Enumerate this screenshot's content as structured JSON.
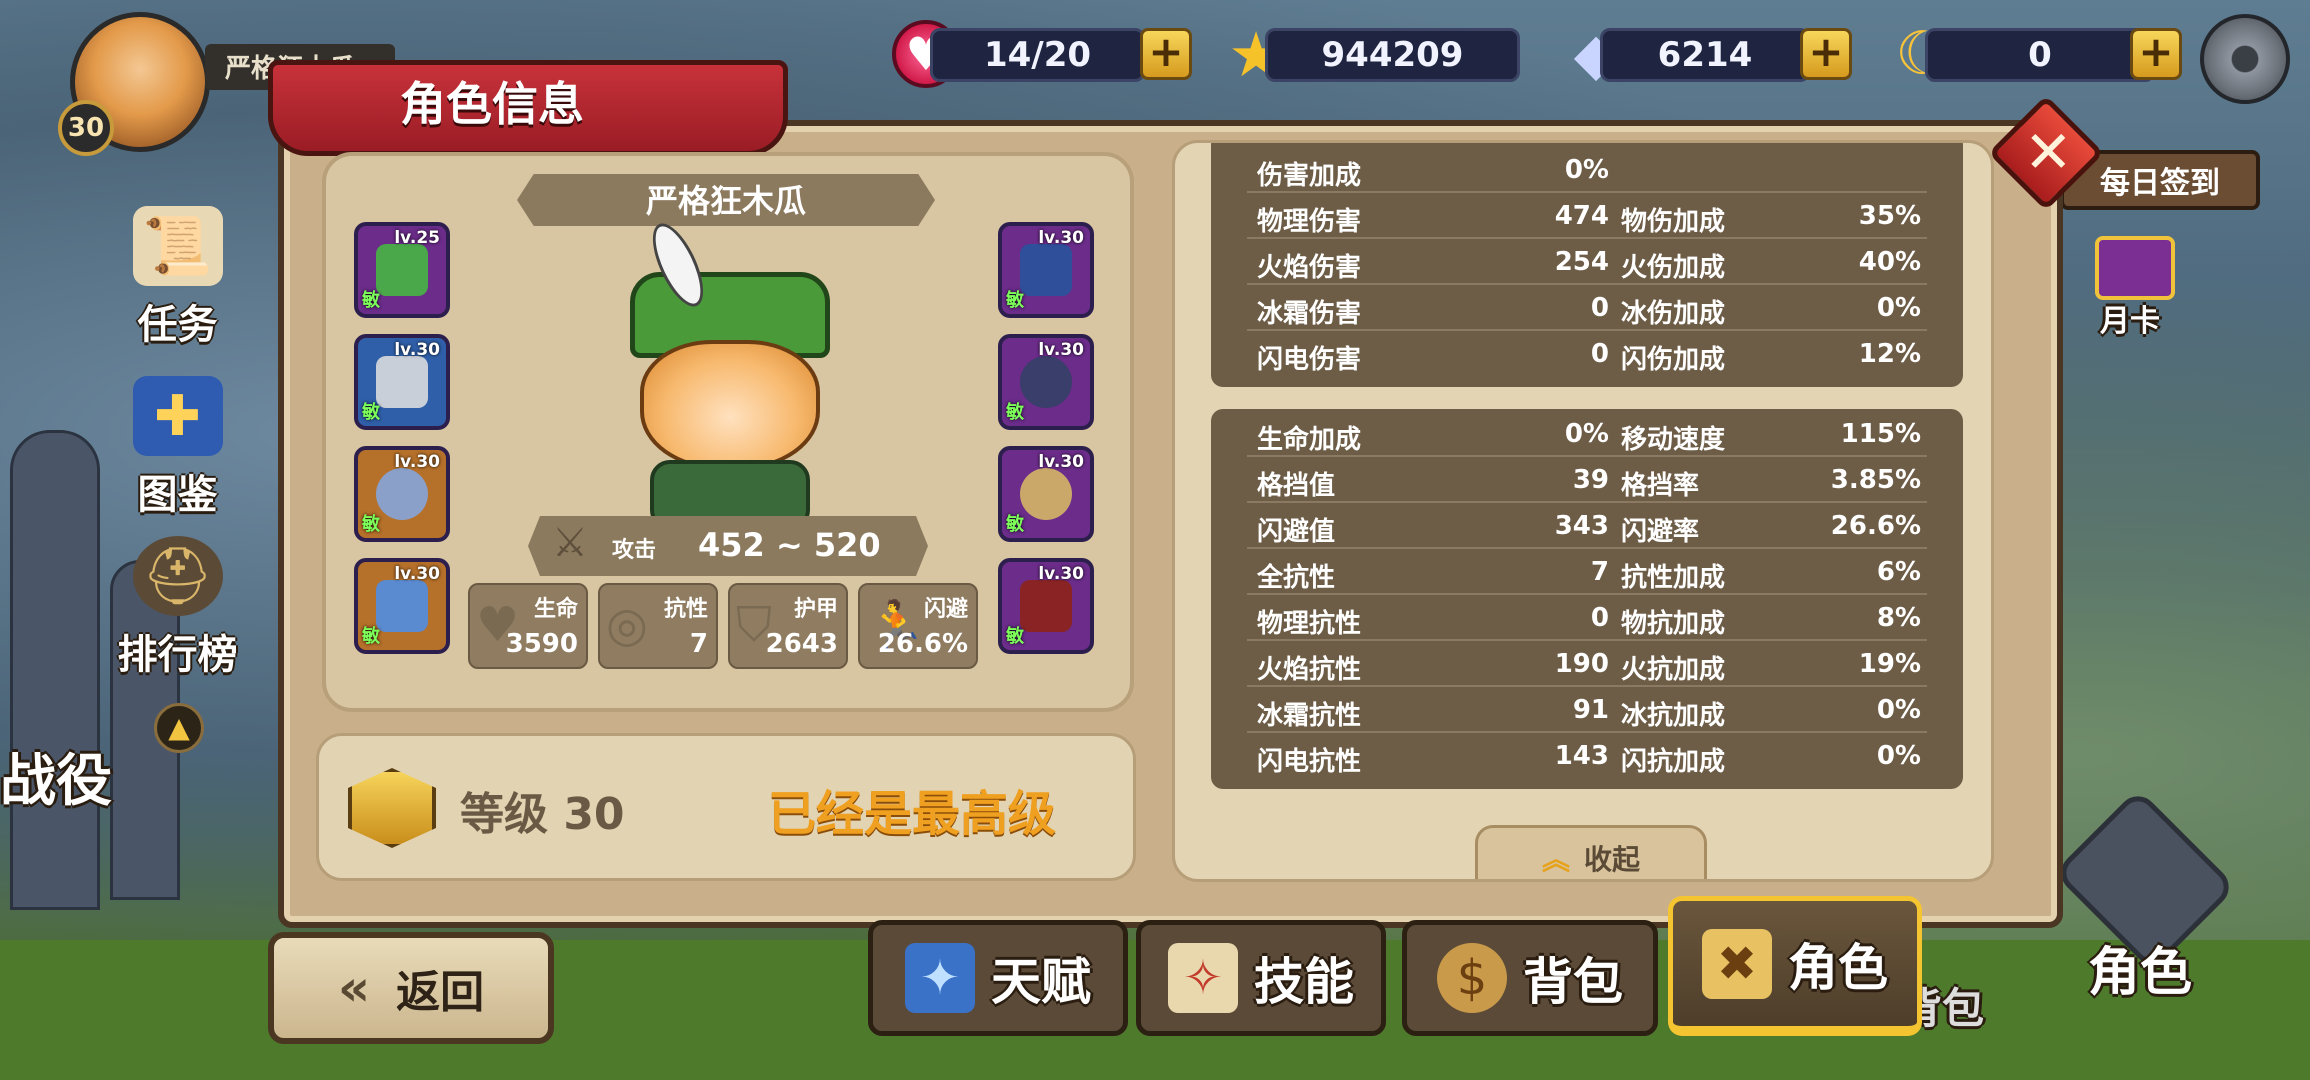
{
  "player": {
    "name": "严格狂木瓜",
    "level": "30"
  },
  "resources": {
    "stamina": "14/20",
    "gold": "944209",
    "diamonds": "6214",
    "moons": "0"
  },
  "left_menu": {
    "quest": "任务",
    "codex": "图鉴",
    "ranking": "排行榜",
    "campaign": "战役"
  },
  "right_side": {
    "daily_signin": "每日签到",
    "monthly_card": "月卡",
    "role": "角色",
    "bag_ghost": "背包"
  },
  "panel": {
    "title": "角色信息",
    "hero_name": "严格狂木瓜",
    "attack_label": "攻击",
    "attack_value": "452 ~ 520",
    "stats": [
      {
        "name": "生命",
        "value": "3590"
      },
      {
        "name": "抗性",
        "value": "7"
      },
      {
        "name": "护甲",
        "value": "2643"
      },
      {
        "name": "闪避",
        "value": "26.6%"
      }
    ],
    "level_label": "等级 30",
    "max_level_text": "已经是最高级",
    "collapse_label": "收起"
  },
  "equipment": {
    "left": [
      {
        "level": "lv.25",
        "tag": "敏"
      },
      {
        "level": "lv.30",
        "tag": "敏"
      },
      {
        "level": "lv.30",
        "tag": "敏"
      },
      {
        "level": "lv.30",
        "tag": "敏"
      }
    ],
    "right": [
      {
        "level": "lv.30",
        "tag": "敏"
      },
      {
        "level": "lv.30",
        "tag": "敏"
      },
      {
        "level": "lv.30",
        "tag": "敏"
      },
      {
        "level": "lv.30",
        "tag": "敏"
      }
    ]
  },
  "damage_stats": [
    {
      "k1": "伤害加成",
      "v1": "0%",
      "k2": "",
      "v2": ""
    },
    {
      "k1": "物理伤害",
      "v1": "474",
      "k2": "物伤加成",
      "v2": "35%"
    },
    {
      "k1": "火焰伤害",
      "v1": "254",
      "k2": "火伤加成",
      "v2": "40%"
    },
    {
      "k1": "冰霜伤害",
      "v1": "0",
      "k2": "冰伤加成",
      "v2": "0%"
    },
    {
      "k1": "闪电伤害",
      "v1": "0",
      "k2": "闪伤加成",
      "v2": "12%"
    }
  ],
  "defense_stats": [
    {
      "k1": "生命加成",
      "v1": "0%",
      "k2": "移动速度",
      "v2": "115%"
    },
    {
      "k1": "格挡值",
      "v1": "39",
      "k2": "格挡率",
      "v2": "3.85%"
    },
    {
      "k1": "闪避值",
      "v1": "343",
      "k2": "闪避率",
      "v2": "26.6%"
    },
    {
      "k1": "全抗性",
      "v1": "7",
      "k2": "抗性加成",
      "v2": "6%"
    },
    {
      "k1": "物理抗性",
      "v1": "0",
      "k2": "物抗加成",
      "v2": "8%"
    },
    {
      "k1": "火焰抗性",
      "v1": "190",
      "k2": "火抗加成",
      "v2": "19%"
    },
    {
      "k1": "冰霜抗性",
      "v1": "91",
      "k2": "冰抗加成",
      "v2": "0%"
    },
    {
      "k1": "闪电抗性",
      "v1": "143",
      "k2": "闪抗加成",
      "v2": "0%"
    }
  ],
  "bottom_tabs": {
    "back": "返回",
    "talent": "天赋",
    "skill": "技能",
    "bag": "背包",
    "role": "角色"
  },
  "icons": {
    "stamina": "heart-icon",
    "gold": "star-icon",
    "diamonds": "diamond-icon",
    "moons": "moon-icon",
    "settings": "gear-icon",
    "close": "close-icon"
  },
  "colors": {
    "panel": "#c9b08a",
    "stat_block": "#6d5d47",
    "ribbon": "#b8262c",
    "max_level": "#f0a020",
    "tab_active": "#f4c531"
  }
}
